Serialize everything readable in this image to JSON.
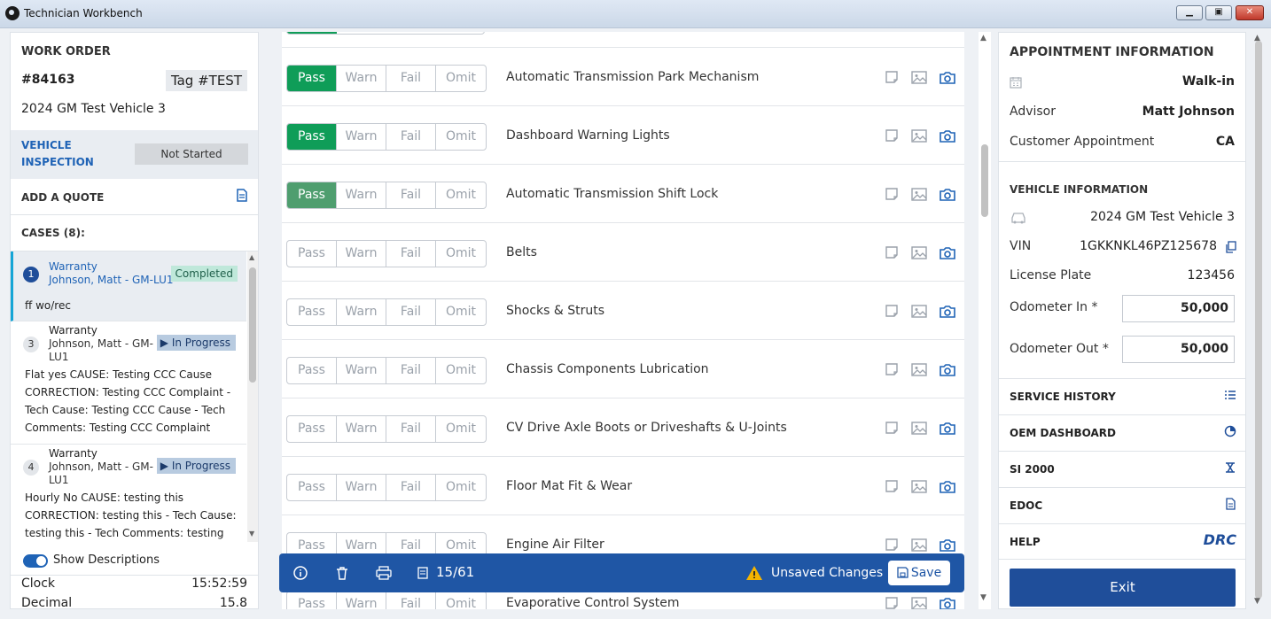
{
  "window": {
    "title": "Technician Workbench"
  },
  "work_order": {
    "header": "WORK ORDER",
    "number": "#84163",
    "tag": "Tag #TEST",
    "vehicle": "2024 GM Test Vehicle 3",
    "inspection_label_1": "VEHICLE",
    "inspection_label_2": "INSPECTION",
    "inspection_status": "Not Started",
    "add_quote": "ADD A QUOTE",
    "cases_header": "CASES (8):"
  },
  "cases": [
    {
      "num": "1",
      "title": "Warranty",
      "sub1": "Johnson, Matt - GM-LU1",
      "sub2": "",
      "badge": "Completed",
      "desc": [
        "ff wo/rec"
      ]
    },
    {
      "num": "3",
      "title": "Warranty",
      "sub1": "Johnson, Matt - GM-",
      "sub2": "LU1",
      "badge": "In Progress",
      "desc": [
        "Flat yes CAUSE: Testing CCC Cause",
        "CORRECTION: Testing CCC Complaint -",
        "Tech Cause: Testing CCC Cause - Tech",
        "Comments: Testing CCC Complaint"
      ]
    },
    {
      "num": "4",
      "title": "Warranty",
      "sub1": "Johnson, Matt - GM-",
      "sub2": "LU1",
      "badge": "In Progress",
      "desc": [
        "Hourly No CAUSE: testing this",
        "CORRECTION: testing this - Tech Cause:",
        "testing this - Tech Comments: testing this"
      ]
    }
  ],
  "footer": {
    "show_descriptions": "Show Descriptions",
    "clock_label": "Clock",
    "clock_value": "15:52:59",
    "decimal_label": "Decimal",
    "decimal_value": "15.8"
  },
  "inspection": {
    "options": [
      "Pass",
      "Warn",
      "Fail",
      "Omit"
    ],
    "items": [
      {
        "label": "Automatic Transmission Park Mechanism",
        "state": "Pass"
      },
      {
        "label": "Dashboard Warning Lights",
        "state": "Pass"
      },
      {
        "label": "Automatic Transmission Shift Lock",
        "state": "Pass"
      },
      {
        "label": "Belts",
        "state": ""
      },
      {
        "label": "Shocks & Struts",
        "state": ""
      },
      {
        "label": "Chassis Components Lubrication",
        "state": ""
      },
      {
        "label": "CV Drive Axle Boots or Driveshafts & U-Joints",
        "state": ""
      },
      {
        "label": "Floor Mat Fit & Wear",
        "state": ""
      },
      {
        "label": "Engine Air Filter",
        "state": ""
      },
      {
        "label": "Evaporative Control System",
        "state": ""
      }
    ]
  },
  "bottom_bar": {
    "page": "15/61",
    "unsaved": "Unsaved Changes",
    "save": "Save"
  },
  "appointment": {
    "header": "APPOINTMENT INFORMATION",
    "type": "Walk-in",
    "advisor_label": "Advisor",
    "advisor_value": "Matt Johnson",
    "cust_label": "Customer Appointment",
    "cust_value": "CA"
  },
  "vehicle_info": {
    "header": "VEHICLE INFORMATION",
    "vehicle": "2024 GM Test Vehicle 3",
    "vin_label": "VIN",
    "vin_value": "1GKKNKL46PZ125678",
    "plate_label": "License Plate",
    "plate_value": "123456",
    "odo_in_label": "Odometer In *",
    "odo_in_value": "50,000",
    "odo_out_label": "Odometer Out *",
    "odo_out_value": "50,000"
  },
  "menu": {
    "service_history": "SERVICE HISTORY",
    "oem_dashboard": "OEM DASHBOARD",
    "si2000": "SI 2000",
    "edoc": "EDOC",
    "help": "HELP",
    "drc_logo": "DRC",
    "exit": "Exit"
  },
  "colors": {
    "primary": "#1f56a5",
    "pass": "#0f9d58",
    "accent": "#15a5d6"
  }
}
